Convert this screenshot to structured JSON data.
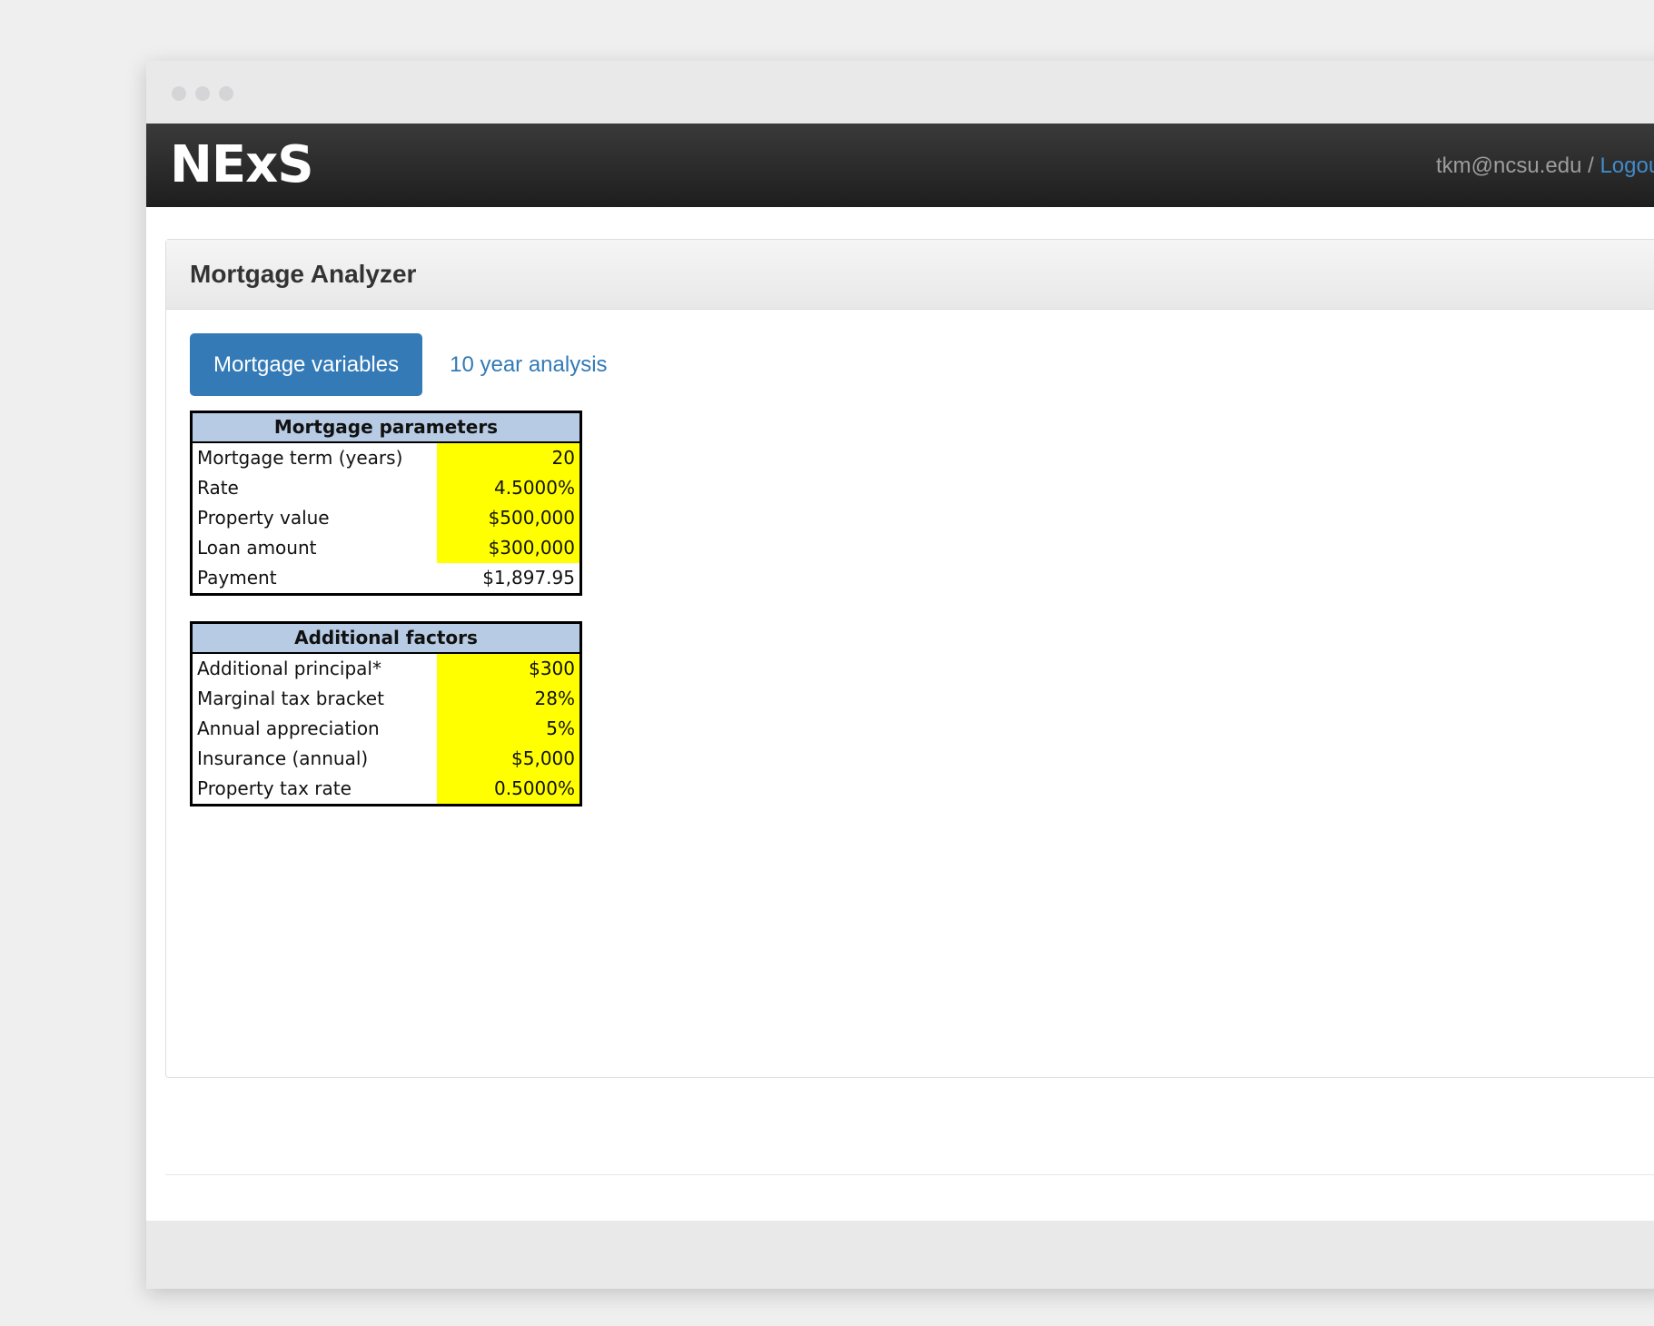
{
  "navbar": {
    "logo": "NExS",
    "user_email": "tkm@ncsu.edu",
    "separator": " / ",
    "logout_label": "Logout"
  },
  "panel": {
    "title": "Mortgage Analyzer"
  },
  "tabs": {
    "active_label": "Mortgage variables",
    "other_label": "10 year analysis"
  },
  "mortgage_parameters": {
    "title": "Mortgage parameters",
    "rows": [
      {
        "label": "Mortgage term (years)",
        "value": "20",
        "input": true
      },
      {
        "label": "Rate",
        "value": "4.5000%",
        "input": true
      },
      {
        "label": "Property value",
        "value": "$500,000",
        "input": true
      },
      {
        "label": "Loan amount",
        "value": "$300,000",
        "input": true
      },
      {
        "label": "Payment",
        "value": "$1,897.95",
        "input": false
      }
    ]
  },
  "additional_factors": {
    "title": "Additional factors",
    "rows": [
      {
        "label": "Additional principal*",
        "value": "$300",
        "input": true
      },
      {
        "label": "Marginal tax bracket",
        "value": "28%",
        "input": true
      },
      {
        "label": "Annual appreciation",
        "value": "5%",
        "input": true
      },
      {
        "label": "Insurance (annual)",
        "value": "$5,000",
        "input": true
      },
      {
        "label": "Property tax rate",
        "value": "0.5000%",
        "input": true
      }
    ]
  },
  "colors": {
    "navbar": "#222222",
    "accent": "#337ab7",
    "input_cell": "#ffff00",
    "sheet_header": "#b7cce4"
  }
}
